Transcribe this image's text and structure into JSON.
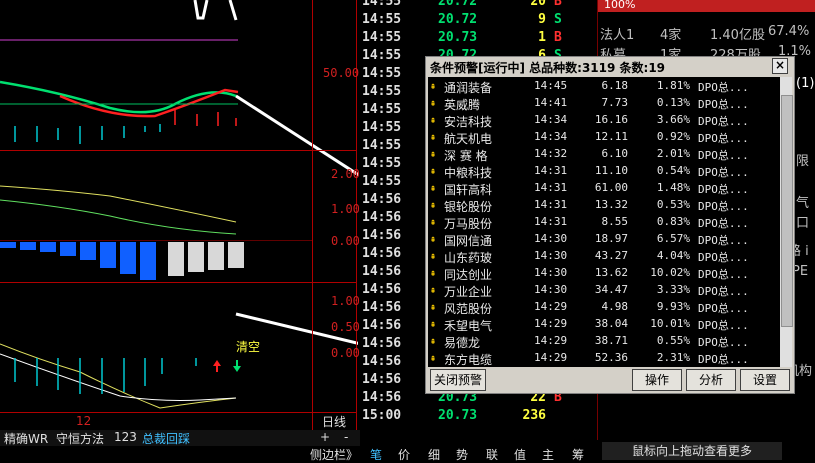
{
  "left_chart": {
    "y_labels_top": [
      "50.00"
    ],
    "y_labels_mid": [
      "2.00",
      "1.00",
      "0.00"
    ],
    "y_labels_bot": [
      "1.00",
      "0.50",
      "0.00"
    ],
    "x_label": "12",
    "clear_label": "清空",
    "period_label": "日线",
    "plus_label": "+",
    "minus_label": "-"
  },
  "indicator_tabs": [
    "精确WR",
    "守恒方法",
    "123",
    "总裁回踩"
  ],
  "bottom_tabs": [
    "侧边栏》",
    "笔",
    "价",
    "细",
    "势",
    "联",
    "值",
    "主",
    "筹"
  ],
  "ticks": [
    {
      "time": "14:55",
      "price": "20.72",
      "vol": "20",
      "dir": "B"
    },
    {
      "time": "14:55",
      "price": "20.72",
      "vol": "9",
      "dir": "S"
    },
    {
      "time": "14:55",
      "price": "20.73",
      "vol": "1",
      "dir": "B"
    },
    {
      "time": "14:55",
      "price": "20.72",
      "vol": "6",
      "dir": "S"
    },
    {
      "time": "14:55",
      "price": "",
      "vol": "",
      "dir": ""
    },
    {
      "time": "14:55",
      "price": "",
      "vol": "",
      "dir": ""
    },
    {
      "time": "14:55",
      "price": "",
      "vol": "",
      "dir": ""
    },
    {
      "time": "14:55",
      "price": "",
      "vol": "",
      "dir": ""
    },
    {
      "time": "14:55",
      "price": "",
      "vol": "",
      "dir": ""
    },
    {
      "time": "14:55",
      "price": "",
      "vol": "",
      "dir": ""
    },
    {
      "time": "14:55",
      "price": "",
      "vol": "",
      "dir": ""
    },
    {
      "time": "14:56",
      "price": "",
      "vol": "",
      "dir": ""
    },
    {
      "time": "14:56",
      "price": "",
      "vol": "",
      "dir": ""
    },
    {
      "time": "14:56",
      "price": "",
      "vol": "",
      "dir": ""
    },
    {
      "time": "14:56",
      "price": "",
      "vol": "",
      "dir": ""
    },
    {
      "time": "14:56",
      "price": "",
      "vol": "",
      "dir": ""
    },
    {
      "time": "14:56",
      "price": "",
      "vol": "",
      "dir": ""
    },
    {
      "time": "14:56",
      "price": "",
      "vol": "",
      "dir": ""
    },
    {
      "time": "14:56",
      "price": "",
      "vol": "",
      "dir": ""
    },
    {
      "time": "14:56",
      "price": "",
      "vol": "",
      "dir": ""
    },
    {
      "time": "14:56",
      "price": "",
      "vol": "",
      "dir": ""
    },
    {
      "time": "14:56",
      "price": "20.72",
      "vol": "",
      "dir": ""
    },
    {
      "time": "14:56",
      "price": "20.73",
      "vol": "22",
      "dir": "B"
    },
    {
      "time": "15:00",
      "price": "20.73",
      "vol": "236",
      "dir": ""
    }
  ],
  "right_panel": {
    "top_pct": "100%",
    "holders": [
      {
        "label": "法人1",
        "count": "4家",
        "shares": "1.40亿股",
        "pct": "67.4%"
      },
      {
        "label": "私募",
        "count": "1家",
        "shares": "228万股",
        "pct": "1.1%"
      }
    ],
    "side_fragments": [
      "(1)",
      "限",
      "气",
      "口",
      "路 i",
      "PE",
      "机构"
    ],
    "hint": "鼠标向上拖动查看更多"
  },
  "dialog": {
    "title": "条件预警[运行中] 总品种数:3119 条数:19",
    "close": "×",
    "rows": [
      {
        "name": "通润装备",
        "time": "14:45",
        "price": "6.18",
        "pct": "1.81%",
        "type": "DPO总..."
      },
      {
        "name": "英威腾",
        "time": "14:41",
        "price": "7.73",
        "pct": "0.13%",
        "type": "DPO总..."
      },
      {
        "name": "安洁科技",
        "time": "14:34",
        "price": "16.16",
        "pct": "3.66%",
        "type": "DPO总..."
      },
      {
        "name": "航天机电",
        "time": "14:34",
        "price": "12.11",
        "pct": "0.92%",
        "type": "DPO总..."
      },
      {
        "name": "深 赛 格",
        "time": "14:32",
        "price": "6.10",
        "pct": "2.01%",
        "type": "DPO总..."
      },
      {
        "name": "中粮科技",
        "time": "14:31",
        "price": "11.10",
        "pct": "0.54%",
        "type": "DPO总..."
      },
      {
        "name": "国轩高科",
        "time": "14:31",
        "price": "61.00",
        "pct": "1.48%",
        "type": "DPO总..."
      },
      {
        "name": "银轮股份",
        "time": "14:31",
        "price": "13.32",
        "pct": "0.53%",
        "type": "DPO总..."
      },
      {
        "name": "万马股份",
        "time": "14:31",
        "price": "8.55",
        "pct": "0.83%",
        "type": "DPO总..."
      },
      {
        "name": "国网信通",
        "time": "14:30",
        "price": "18.97",
        "pct": "6.57%",
        "type": "DPO总..."
      },
      {
        "name": "山东药玻",
        "time": "14:30",
        "price": "43.27",
        "pct": "4.04%",
        "type": "DPO总..."
      },
      {
        "name": "同达创业",
        "time": "14:30",
        "price": "13.62",
        "pct": "10.02%",
        "type": "DPO总..."
      },
      {
        "name": "万业企业",
        "time": "14:30",
        "price": "34.47",
        "pct": "3.33%",
        "type": "DPO总..."
      },
      {
        "name": "风范股份",
        "time": "14:29",
        "price": "4.98",
        "pct": "9.93%",
        "type": "DPO总..."
      },
      {
        "name": "禾望电气",
        "time": "14:29",
        "price": "38.04",
        "pct": "10.01%",
        "type": "DPO总..."
      },
      {
        "name": "易德龙",
        "time": "14:29",
        "price": "38.71",
        "pct": "0.55%",
        "type": "DPO总..."
      },
      {
        "name": "东方电缆",
        "time": "14:29",
        "price": "52.36",
        "pct": "2.31%",
        "type": "DPO总..."
      }
    ],
    "buttons": {
      "close": "关闭预警",
      "operate": "操作",
      "analyze": "分析",
      "settings": "设置"
    }
  },
  "colors": {
    "up": "#ff3030",
    "down": "#00e070",
    "accent": "#ffff40",
    "grid": "#b00000"
  }
}
